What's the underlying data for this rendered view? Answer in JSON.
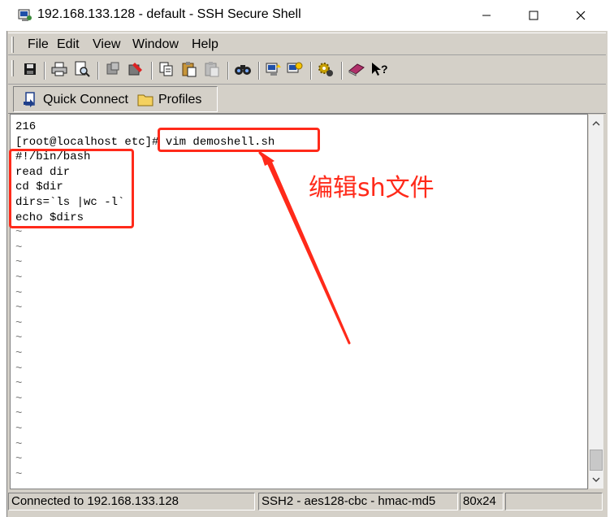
{
  "window": {
    "title": "192.168.133.128 - default - SSH Secure Shell",
    "minimize_icon": "minimize-icon",
    "maximize_icon": "maximize-icon",
    "close_icon": "close-icon"
  },
  "menu": {
    "items": [
      {
        "label": "File"
      },
      {
        "label": "Edit"
      },
      {
        "label": "View"
      },
      {
        "label": "Window"
      },
      {
        "label": "Help"
      }
    ]
  },
  "toolbar": {
    "buttons": [
      {
        "icon": "save-icon"
      },
      {
        "icon": "print-icon"
      },
      {
        "icon": "print-preview-icon"
      },
      {
        "icon": "disconnect-icon"
      },
      {
        "icon": "connect-icon"
      },
      {
        "icon": "copy-icon"
      },
      {
        "icon": "paste-icon"
      },
      {
        "icon": "paste-disabled-icon"
      },
      {
        "icon": "find-icon"
      },
      {
        "icon": "file-transfer-icon"
      },
      {
        "icon": "new-terminal-icon"
      },
      {
        "icon": "settings-icon"
      },
      {
        "icon": "help-book-icon"
      },
      {
        "icon": "context-help-icon"
      }
    ]
  },
  "quickbar": {
    "quick_connect_label": "Quick Connect",
    "profiles_label": "Profiles"
  },
  "terminal": {
    "lines": [
      "216",
      "[root@localhost etc]# vim demoshell.sh",
      "#!/bin/bash",
      "read dir",
      "cd $dir",
      "dirs=`ls |wc -l`",
      "echo $dirs"
    ],
    "tilde": "~",
    "tilde_count": 17
  },
  "annotation": {
    "text": "编辑sh文件",
    "color": "#ff2a1a"
  },
  "statusbar": {
    "connection": "Connected to 192.168.133.128",
    "cipher": "SSH2 - aes128-cbc - hmac-md5",
    "size": "80x24"
  },
  "colors": {
    "chrome": "#d4d0c8",
    "terminal_bg": "#ffffff",
    "annotation_red": "#ff2a1a"
  }
}
